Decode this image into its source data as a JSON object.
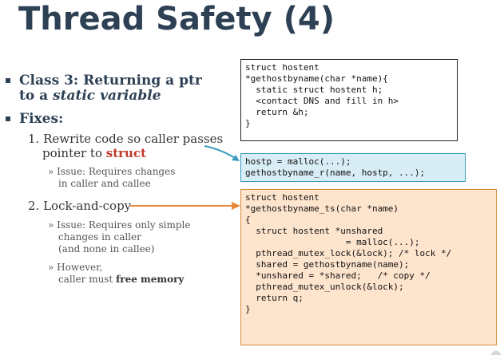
{
  "title": "Thread Safety (4)",
  "bullets": {
    "class3_line1": "Class 3: Returning a ptr",
    "class3_line2_prefix": "to a ",
    "class3_line2_italic": "static variable",
    "fixes": "Fixes:"
  },
  "fix1": {
    "line1": "1. Rewrite code so caller passes",
    "line2_prefix": "pointer to ",
    "line2_bold": "struct",
    "issue_line1": "» Issue: Requires changes",
    "issue_line2": "in caller and callee"
  },
  "fix2": {
    "label": "2. Lock-and-copy",
    "issue_line1": "» Issue: Requires only simple",
    "issue_line2": "changes in caller",
    "issue_line3": "(and none in callee)",
    "however_line1": "» However,",
    "however_line2_prefix": "caller must ",
    "however_line2_bold": "free memory"
  },
  "code_original": "struct hostent\n*gethostbyname(char *name){\n  static struct hostent h;\n  <contact DNS and fill in h>\n  return &h;\n}",
  "code_caller": "hostp = malloc(...);\ngethostbyname_r(name, hostp, ...);",
  "code_lockcopy": "struct hostent\n*gethostbyname_ts(char *name)\n{\n  struct hostent *unshared\n                   = malloc(...);\n  pthread_mutex_lock(&lock); /* lock */\n  shared = gethostbyname(name);\n  *unshared = *shared;   /* copy */\n  pthread_mutex_unlock(&lock);\n  return q;\n}",
  "colors": {
    "title": "#2d4054",
    "accent_red": "#c0392b",
    "caller_box_bg": "#d8edf5",
    "caller_box_border": "#3a9bbd",
    "lockcopy_box_bg": "#fde4cc",
    "lockcopy_box_border": "#d88a3b"
  }
}
